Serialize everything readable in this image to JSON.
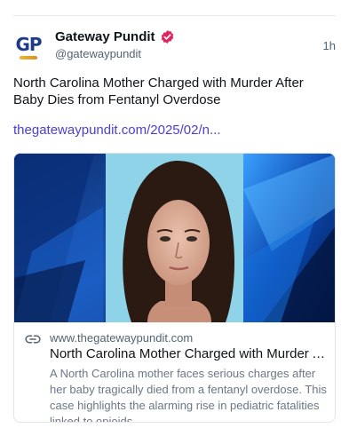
{
  "post": {
    "author": {
      "display_name": "Gateway Pundit",
      "handle": "@gatewaypundit",
      "avatar_text": "GP",
      "verified_icon": "verified-badge-icon"
    },
    "time": "1h",
    "text": "North Carolina Mother Charged with Murder After Baby Dies from Fentanyl Overdose",
    "link_text": "thegatewaypundit.com/2025/02/n..."
  },
  "card": {
    "image_icon": "news-photo",
    "link_icon": "link-icon",
    "domain": "www.thegatewaypundit.com",
    "title": "North Carolina Mother Charged with Murder Af...",
    "description": "A North Carolina mother faces serious charges after her baby tragically died from a fentanyl overdose. This case highlights the alarming rise in pediatric fatalities linked to opioids."
  },
  "colors": {
    "link": "#4a3fd6",
    "verified": "#e0245e",
    "brand_blue": "#1e3a8a",
    "brand_gold": "#f0b52b"
  }
}
